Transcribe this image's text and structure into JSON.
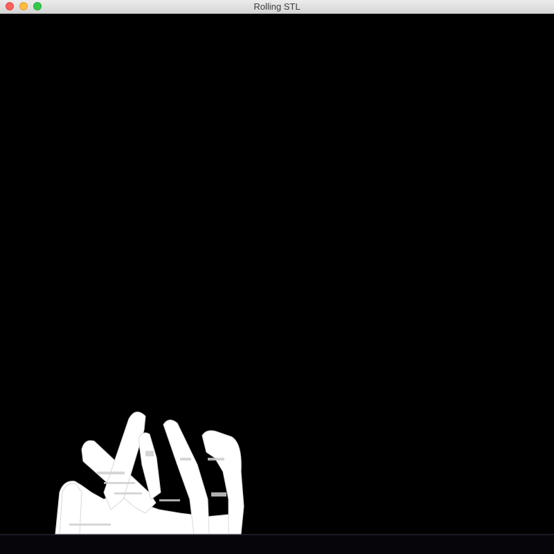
{
  "window": {
    "title": "Rolling STL",
    "controls": {
      "close_color": "#fc605c",
      "minimize_color": "#fdbc40",
      "maximize_color": "#34c84a"
    }
  },
  "viewport": {
    "background_color": "#000000",
    "model_color": "#ffffff",
    "floor_color": "#0a0a12"
  }
}
